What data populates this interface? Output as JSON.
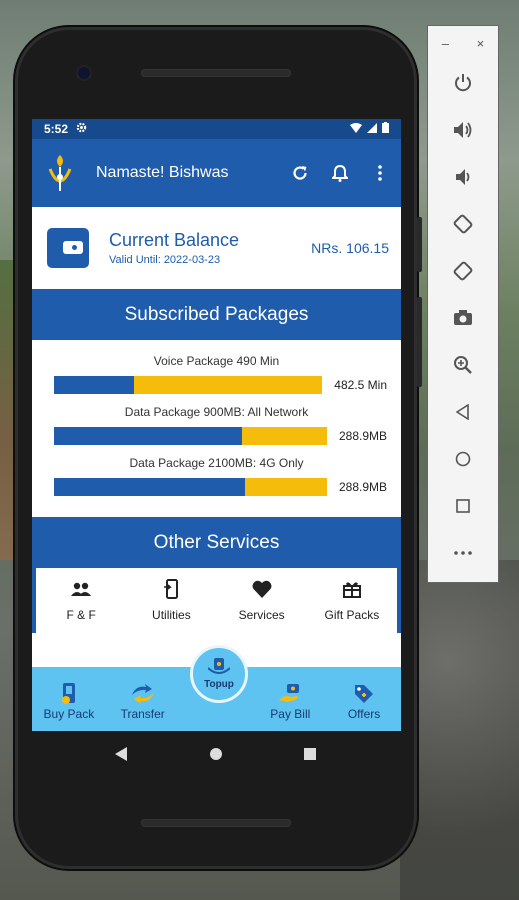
{
  "status": {
    "time": "5:52"
  },
  "appbar": {
    "title": "Namaste! Bishwas"
  },
  "balance": {
    "label": "Current Balance",
    "valid_until": "Valid Until: 2022-03-23",
    "amount": "NRs. 106.15"
  },
  "packages": {
    "heading": "Subscribed Packages",
    "items": [
      {
        "name": "Voice Package 490 Min",
        "remaining": "482.5 Min",
        "used_fraction": 0.3
      },
      {
        "name": "Data Package 900MB: All Network",
        "remaining": "288.9MB",
        "used_fraction": 0.69
      },
      {
        "name": "Data Package 2100MB: 4G Only",
        "remaining": "288.9MB",
        "used_fraction": 0.7
      }
    ]
  },
  "other": {
    "heading": "Other Services",
    "items": [
      "F & F",
      "Utilities",
      "Services",
      "Gift Packs"
    ]
  },
  "bottomnav": {
    "buy_pack": "Buy Pack",
    "transfer": "Transfer",
    "topup": "Topup",
    "pay_bill": "Pay Bill",
    "offers": "Offers"
  },
  "toolbar": {
    "minimize": "–",
    "close": "×"
  },
  "colors": {
    "primary": "#1f5cab",
    "accent": "#f6bc0c",
    "nav": "#5ec3f0"
  }
}
